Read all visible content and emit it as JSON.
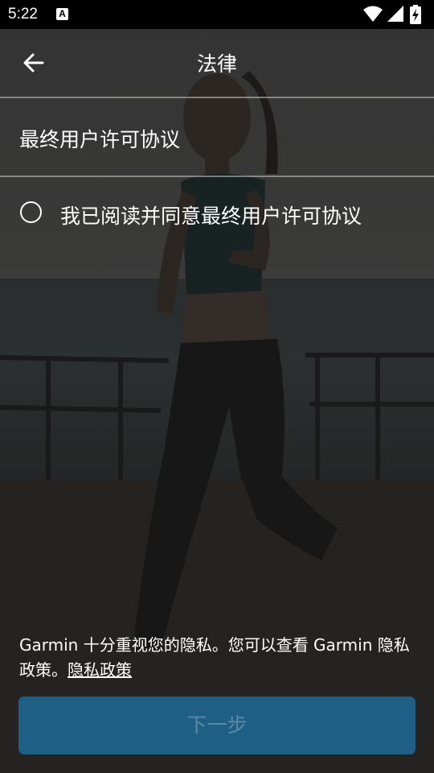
{
  "status_bar": {
    "time": "5:22",
    "notification_icon": "a-letter-icon",
    "notification_letter": "A",
    "icons": [
      "wifi-icon",
      "signal-icon",
      "battery-charging-icon"
    ]
  },
  "header": {
    "title": "法律",
    "back_icon": "arrow-left-icon"
  },
  "eula": {
    "label": "最终用户许可协议"
  },
  "agree": {
    "label": "我已阅读并同意最终用户许可协议",
    "checked": false
  },
  "privacy": {
    "text": "Garmin 十分重视您的隐私。您可以查看 Garmin 隐私政策。",
    "link_label": "隐私政策"
  },
  "next_button": {
    "label": "下一步",
    "enabled": false
  },
  "colors": {
    "button_bg": "#1f5f86",
    "button_text_disabled": "#5d89a6",
    "text": "#ffffff"
  }
}
